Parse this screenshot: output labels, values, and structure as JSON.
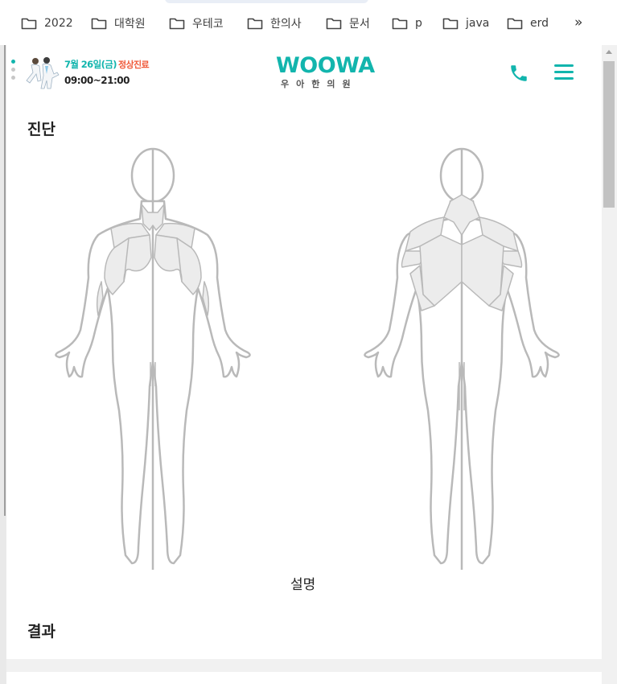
{
  "bookmarks": [
    {
      "label": "2022"
    },
    {
      "label": "대학원"
    },
    {
      "label": "우테코"
    },
    {
      "label": "한의사"
    },
    {
      "label": "문서"
    },
    {
      "label": "p"
    },
    {
      "label": "java"
    },
    {
      "label": "erd"
    }
  ],
  "bookmarks_more_label": "»",
  "header": {
    "date": "7월 26일(금)",
    "status": "정상진료",
    "hours": "09:00~21:00",
    "logo_main": "WOOWA",
    "logo_sub": "우아한의원"
  },
  "colors": {
    "accent": "#12b5ad",
    "status": "#f05a3a",
    "outline": "#b9b9b9",
    "muscle": "#ececec"
  },
  "content": {
    "diagnosis_title": "진단",
    "description_label": "설명",
    "result_title": "결과"
  },
  "icons": [
    "folder-icon",
    "chevron-double-right-icon",
    "phone-icon",
    "hamburger-menu-icon"
  ]
}
